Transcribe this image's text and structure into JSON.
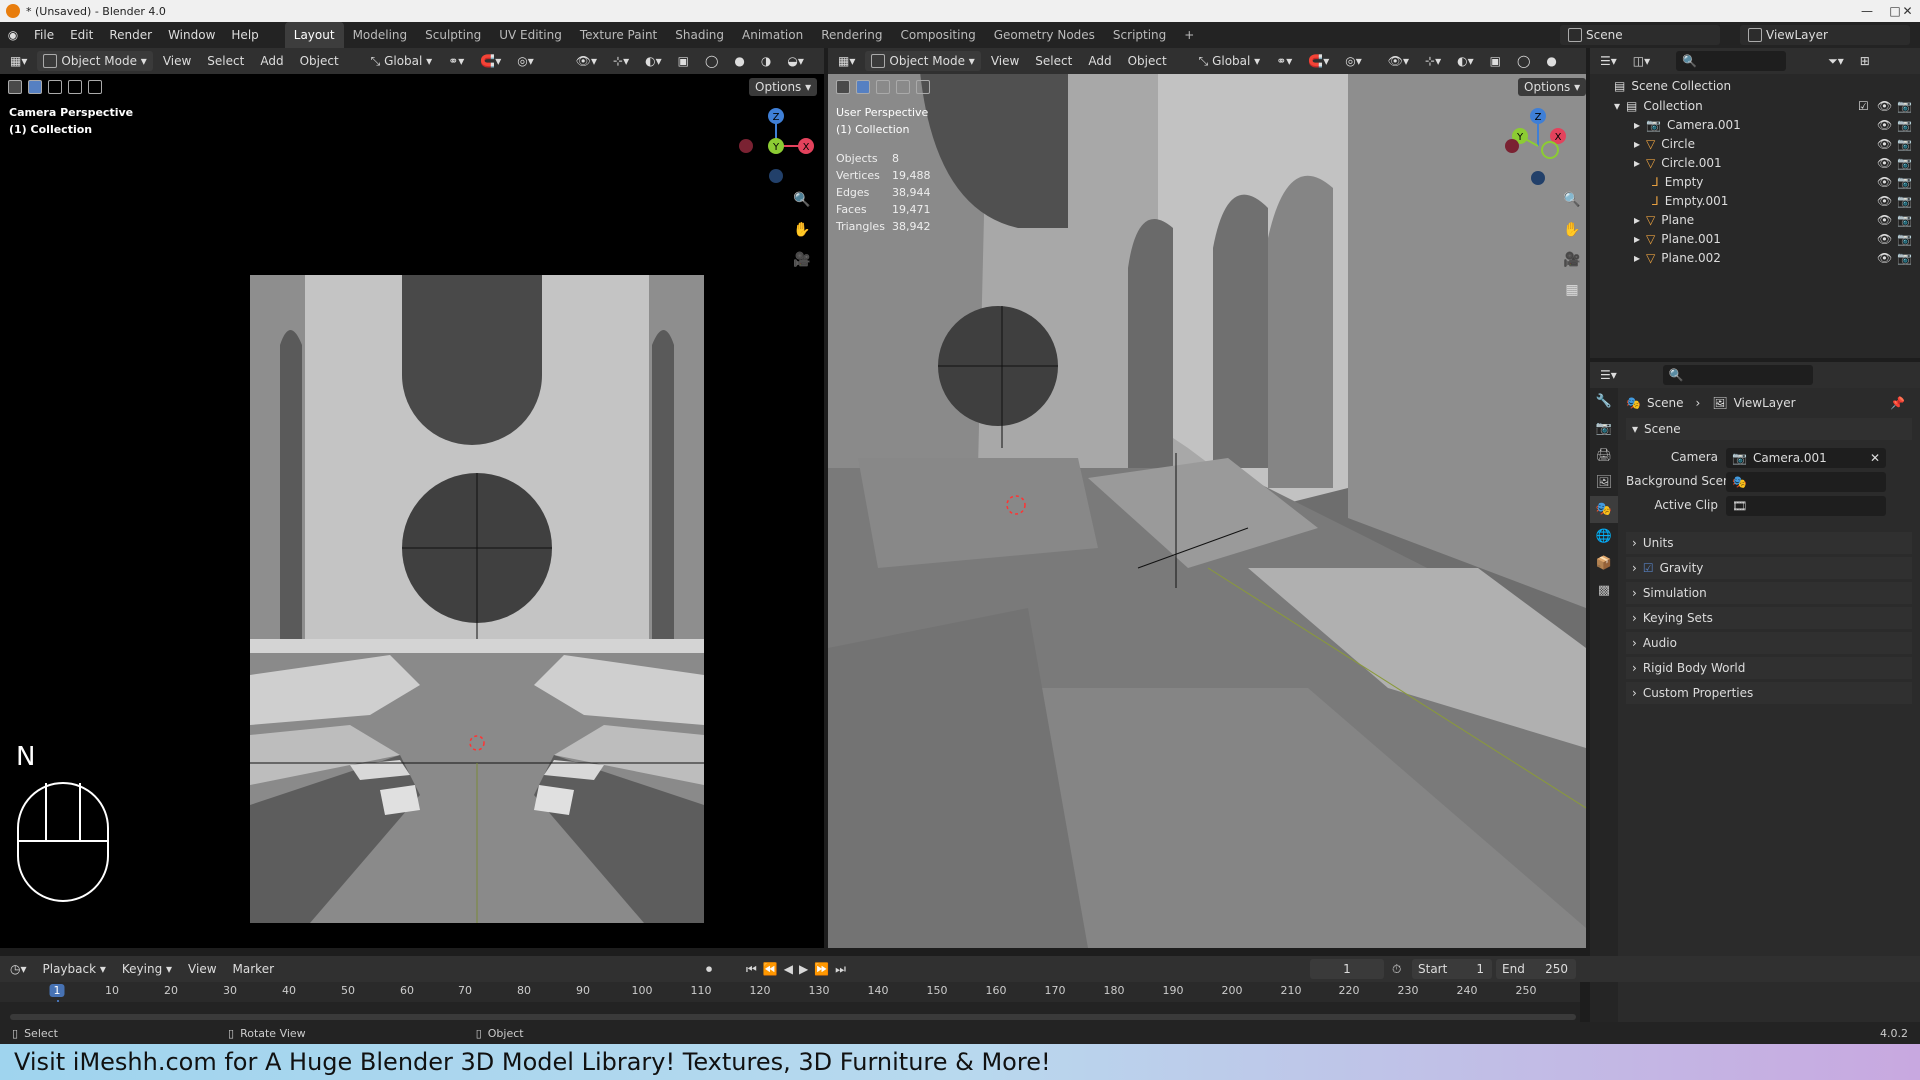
{
  "app": {
    "title": "* (Unsaved) - Blender 4.0",
    "version": "4.0.2"
  },
  "menu": [
    "File",
    "Edit",
    "Render",
    "Window",
    "Help"
  ],
  "workspaces": [
    "Layout",
    "Modeling",
    "Sculpting",
    "UV Editing",
    "Texture Paint",
    "Shading",
    "Animation",
    "Rendering",
    "Compositing",
    "Geometry Nodes",
    "Scripting",
    "+"
  ],
  "scene": {
    "name": "Scene",
    "view_layer": "ViewLayer"
  },
  "left_view": {
    "mode": "Object Mode",
    "menus": [
      "View",
      "Select",
      "Add",
      "Object"
    ],
    "orientation": "Global",
    "options": "Options",
    "title": "Camera Perspective",
    "collection": "(1) Collection",
    "key_label": "N"
  },
  "right_view": {
    "mode": "Object Mode",
    "menus": [
      "View",
      "Select",
      "Add",
      "Object"
    ],
    "orientation": "Global",
    "options": "Options",
    "title": "User Perspective",
    "collection": "(1) Collection",
    "stats": [
      {
        "k": "Objects",
        "v": "8"
      },
      {
        "k": "Vertices",
        "v": "19,488"
      },
      {
        "k": "Edges",
        "v": "38,944"
      },
      {
        "k": "Faces",
        "v": "19,471"
      },
      {
        "k": "Triangles",
        "v": "38,942"
      }
    ]
  },
  "gizmo": {
    "x": "X",
    "y": "Y",
    "z": "Z",
    "x_color": "#e3425c",
    "y_color": "#8ccc33",
    "z_color": "#3f7fd6"
  },
  "outliner": {
    "root": "Scene Collection",
    "collection": "Collection",
    "items": [
      "Camera.001",
      "Circle",
      "Circle.001",
      "Empty",
      "Empty.001",
      "Plane",
      "Plane.001",
      "Plane.002"
    ]
  },
  "properties": {
    "breadcrumb_scene": "Scene",
    "breadcrumb_layer": "ViewLayer",
    "panel": "Scene",
    "camera_label": "Camera",
    "camera_value": "Camera.001",
    "bg_scene_label": "Background Scene",
    "active_clip_label": "Active Clip",
    "sections": [
      "Units",
      "Gravity",
      "Simulation",
      "Keying Sets",
      "Audio",
      "Rigid Body World",
      "Custom Properties"
    ]
  },
  "timeline": {
    "menus": [
      "Playback",
      "Keying",
      "View",
      "Marker"
    ],
    "current_frame": "1",
    "start_label": "Start",
    "start": "1",
    "end_label": "End",
    "end": "250",
    "ticks": [
      "1",
      "10",
      "20",
      "30",
      "40",
      "50",
      "60",
      "70",
      "80",
      "90",
      "100",
      "110",
      "120",
      "130",
      "140",
      "150",
      "160",
      "170",
      "180",
      "190",
      "200",
      "210",
      "220",
      "230",
      "240",
      "250"
    ]
  },
  "status": {
    "select": "Select",
    "rotate": "Rotate View",
    "object": "Object"
  },
  "banner": "Visit iMeshh.com for A Huge Blender 3D Model Library! Textures, 3D Furniture & More!"
}
